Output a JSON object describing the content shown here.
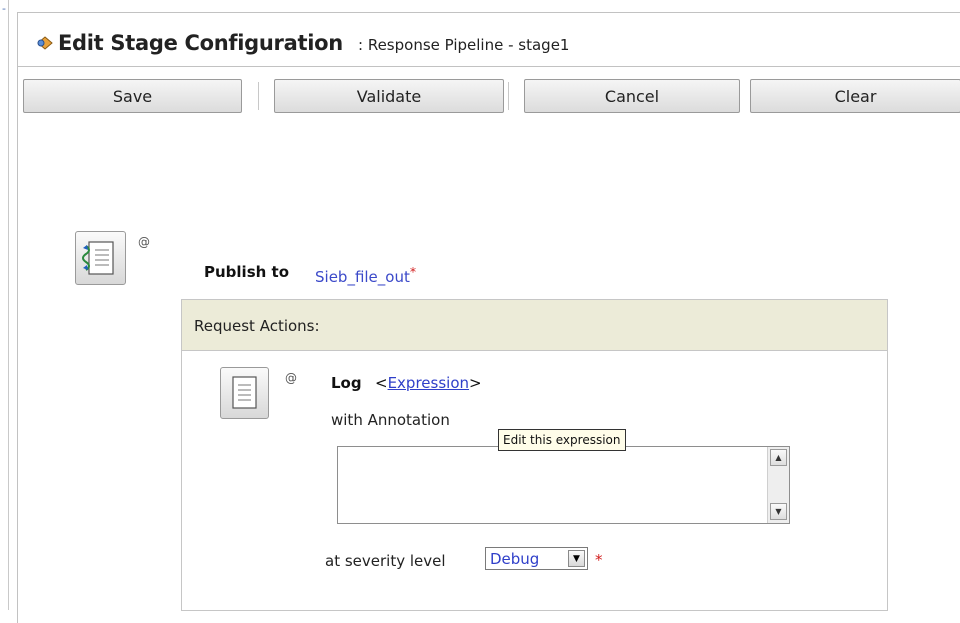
{
  "title": {
    "main": "Edit Stage Configuration",
    "subtitle": ": Response Pipeline - stage1",
    "icon": "pipeline-stage-icon"
  },
  "toolbar": {
    "save_label": "Save",
    "validate_label": "Validate",
    "cancel_label": "Cancel",
    "clear_label": "Clear"
  },
  "publish": {
    "icon": "publish-action-icon",
    "at_label": "@",
    "label": "Publish to",
    "target": "Sieb_file_out",
    "required_mark": "*"
  },
  "request_actions": {
    "header": "Request Actions:",
    "log": {
      "icon": "log-action-icon",
      "at_label": "@",
      "label": "Log",
      "expr_open": "<",
      "expr_link": "Expression",
      "expr_close": ">",
      "annotation_label": "with Annotation",
      "annotation_value": "",
      "tooltip": "Edit this expression",
      "severity_label": "at severity level",
      "severity_value": "Debug",
      "severity_required": "*"
    }
  },
  "colors": {
    "link": "#2f3fc9",
    "required": "#d21f1f",
    "header_bg": "#ecebd8"
  }
}
